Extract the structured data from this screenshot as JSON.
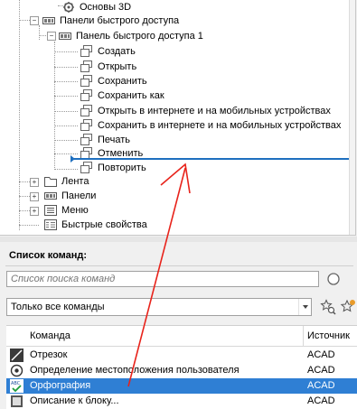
{
  "tree": {
    "items": [
      {
        "label": "Основы 3D"
      },
      {
        "label": "Панели быстрого доступа"
      },
      {
        "label": "Панель быстрого доступа 1"
      },
      {
        "label": "Создать"
      },
      {
        "label": "Открыть"
      },
      {
        "label": "Сохранить"
      },
      {
        "label": "Сохранить как"
      },
      {
        "label": "Открыть в интернете и на мобильных устройствах"
      },
      {
        "label": "Сохранить в интернете и на мобильных устройствах"
      },
      {
        "label": "Печать"
      },
      {
        "label": "Отменить"
      },
      {
        "label": "Повторить"
      },
      {
        "label": "Лента"
      },
      {
        "label": "Панели"
      },
      {
        "label": "Меню"
      },
      {
        "label": "Быстрые свойства"
      }
    ]
  },
  "command_list": {
    "title": "Список команд:",
    "search_placeholder": "Список поиска команд",
    "filter_selected": "Только все команды",
    "columns": {
      "command": "Команда",
      "source": "Источник"
    },
    "rows": [
      {
        "name": "Отрезок",
        "source": "ACAD",
        "icon": "line-icon"
      },
      {
        "name": "Определение местоположения пользователя",
        "source": "ACAD",
        "icon": "geolocation-icon"
      },
      {
        "name": "Орфография",
        "source": "ACAD",
        "icon": "spellcheck-icon",
        "selected": true
      },
      {
        "name": "Описание к блоку...",
        "source": "ACAD",
        "icon": "block-description-icon"
      }
    ]
  },
  "annotation": {
    "arrow_color": "#e8231b"
  },
  "colors": {
    "selection": "#2f7fd4",
    "drop_indicator": "#1e6fbf"
  }
}
